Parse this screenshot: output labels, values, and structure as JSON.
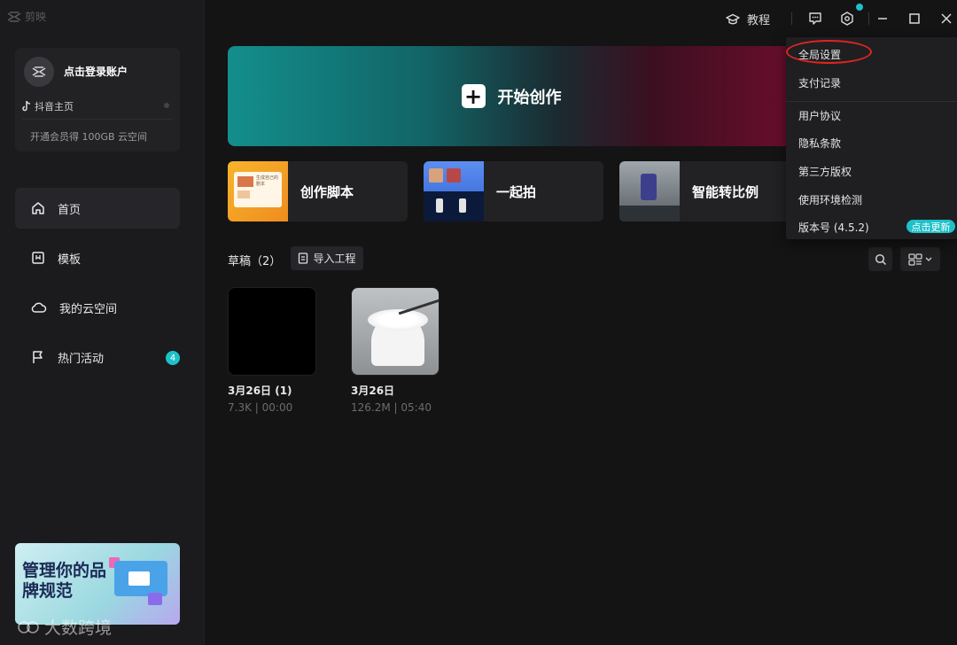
{
  "app": {
    "logo_text": "剪映"
  },
  "sidebar": {
    "account": {
      "login_label": "点击登录账户",
      "douyin_label": "抖音主页",
      "vip_promo": "开通会员得 100GB 云空间"
    },
    "nav": [
      {
        "label": "首页",
        "icon": "home-icon",
        "active": true
      },
      {
        "label": "模板",
        "icon": "template-icon"
      },
      {
        "label": "我的云空间",
        "icon": "cloud-icon"
      },
      {
        "label": "热门活动",
        "icon": "flag-icon",
        "badge": "4"
      }
    ],
    "promo": {
      "title": "管理你的品牌规范"
    }
  },
  "topbar": {
    "tutorial_label": "教程",
    "accent": "#1ec1c9"
  },
  "main": {
    "hero_label": "开始创作",
    "tiles": [
      {
        "label": "创作脚本",
        "thumb_text": "生成自己的剧本"
      },
      {
        "label": "一起拍"
      },
      {
        "label": "智能转比例"
      }
    ],
    "drafts": {
      "title": "草稿（2）",
      "import_label": "导入工程",
      "items": [
        {
          "name": "3月26日 (1)",
          "meta": "7.3K | 00:00"
        },
        {
          "name": "3月26日",
          "meta": "126.2M | 05:40"
        }
      ]
    }
  },
  "menu": {
    "items": [
      "全局设置",
      "支付记录",
      "用户协议",
      "隐私条款",
      "第三方版权",
      "使用环境检测",
      "版本号 (4.5.2)"
    ],
    "update_label": "点击更新",
    "highlight_color": "#e0241f"
  },
  "watermark": "大数跨境"
}
